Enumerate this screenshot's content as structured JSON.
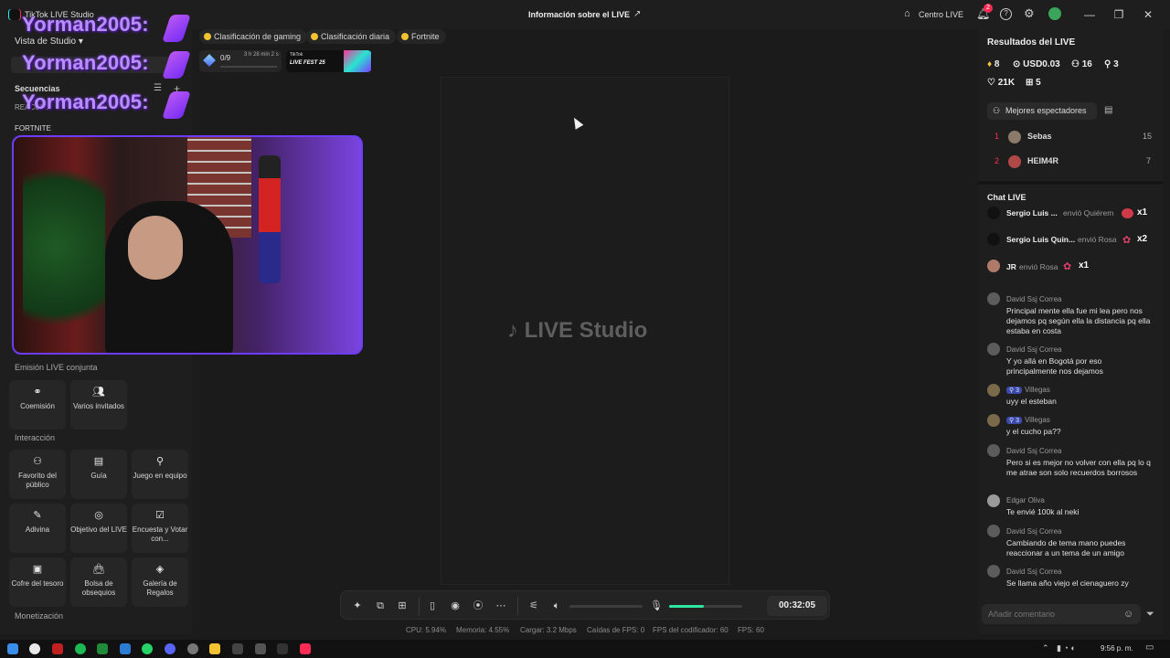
{
  "window": {
    "title": "TikTok LIVE Studio",
    "center_title": "Información sobre el LIVE",
    "centro_live": "Centro LIVE",
    "notif_count": "2"
  },
  "left": {
    "studio_view": "Vista de Studio",
    "sequences": "Secuencias",
    "scene_label": "REACCI...",
    "source_label": "FORTNITE",
    "overlay_name": "Yorman2005:",
    "co_stream_title": "Emisión LIVE conjunta",
    "co_stream": [
      "Coemisión",
      "Varios invitados"
    ],
    "interaction_title": "Interacción",
    "interaction": [
      "Favorito del público",
      "Guía",
      "Juego en equipo",
      "Adivina",
      "Objetivo del LIVE",
      "Encuesta y Votar con...",
      "Cofre del tesoro",
      "Bolsa de obsequios",
      "Galería de Regalos"
    ],
    "monetization_title": "Monetización"
  },
  "top": {
    "pills": [
      "Clasificación de gaming",
      "Clasificación diaria",
      "Fortnite"
    ],
    "goal": "0/9",
    "goal_time": "3 h 28 min 2 s",
    "fest": "LIVE FEST 25",
    "fest_small": "TikTok"
  },
  "canvas": {
    "watermark": "LIVE Studio"
  },
  "toolbar": {
    "timer": "00:32:05",
    "volume_level": 0.0,
    "mic_level": 0.47
  },
  "status": {
    "cpu": "CPU: 5.94%",
    "mem": "Memoria: 4.55%",
    "load": "Cargar: 3.2 Mbps",
    "fps_drop": "Caídas de FPS: 0",
    "enc_fps": "FPS del codificador: 60",
    "fps": "FPS: 60"
  },
  "right": {
    "results_title": "Resultados del LIVE",
    "stats": {
      "diamonds": "8",
      "usd": "USD0.03",
      "viewers": "16",
      "new_followers": "3",
      "likes": "21K",
      "gifts": "5"
    },
    "top_viewers_btn": "Mejores espectadores",
    "top_viewers": [
      {
        "rank": "1",
        "name": "Sebas",
        "score": "15"
      },
      {
        "rank": "2",
        "name": "HEIM4R",
        "score": "7"
      }
    ],
    "chat_title": "Chat LIVE",
    "gifts": [
      {
        "name": "Sergio Luis ...",
        "action": "envió Quiérem",
        "count": "x1"
      },
      {
        "name": "Sergio Luis Quin...",
        "action": "envió Rosa",
        "count": "x2"
      },
      {
        "name": "JR",
        "action": "envió Rosa",
        "count": "x1"
      }
    ],
    "messages": [
      {
        "user": "David Ssj Correa",
        "badge": "",
        "text": "Principal mente ella fue mi lea pero nos dejamos pq según ella la distancia pq ella estaba en costa"
      },
      {
        "user": "David Ssj Correa",
        "badge": "",
        "text": "Y yo allá en Bogotá por eso principalmente nos dejamos"
      },
      {
        "user": "Villegas",
        "badge": "3",
        "text": "uyy el esteban"
      },
      {
        "user": "Villegas",
        "badge": "3",
        "text": "y el cucho pa??"
      },
      {
        "user": "David Ssj Correa",
        "badge": "",
        "text": "Pero si es mejor no volver con ella pq lo q me atrae son solo recuerdos borrosos"
      },
      {
        "user": "Edgar Oliva",
        "badge": "",
        "text": "Te envié 100k al neki"
      },
      {
        "user": "David Ssj Correa",
        "badge": "",
        "text": "Cambiando de tema mano puedes reaccionar a un tema de un amigo"
      },
      {
        "user": "David Ssj Correa",
        "badge": "",
        "text": "Se llama año viejo el cienaguero zy"
      }
    ],
    "comment_placeholder": "Añadir comentario"
  },
  "taskbar": {
    "clock": "9:56 p. m."
  },
  "colors": {
    "accent_green": "#2fe6a0",
    "live_red": "#fe2c55"
  }
}
